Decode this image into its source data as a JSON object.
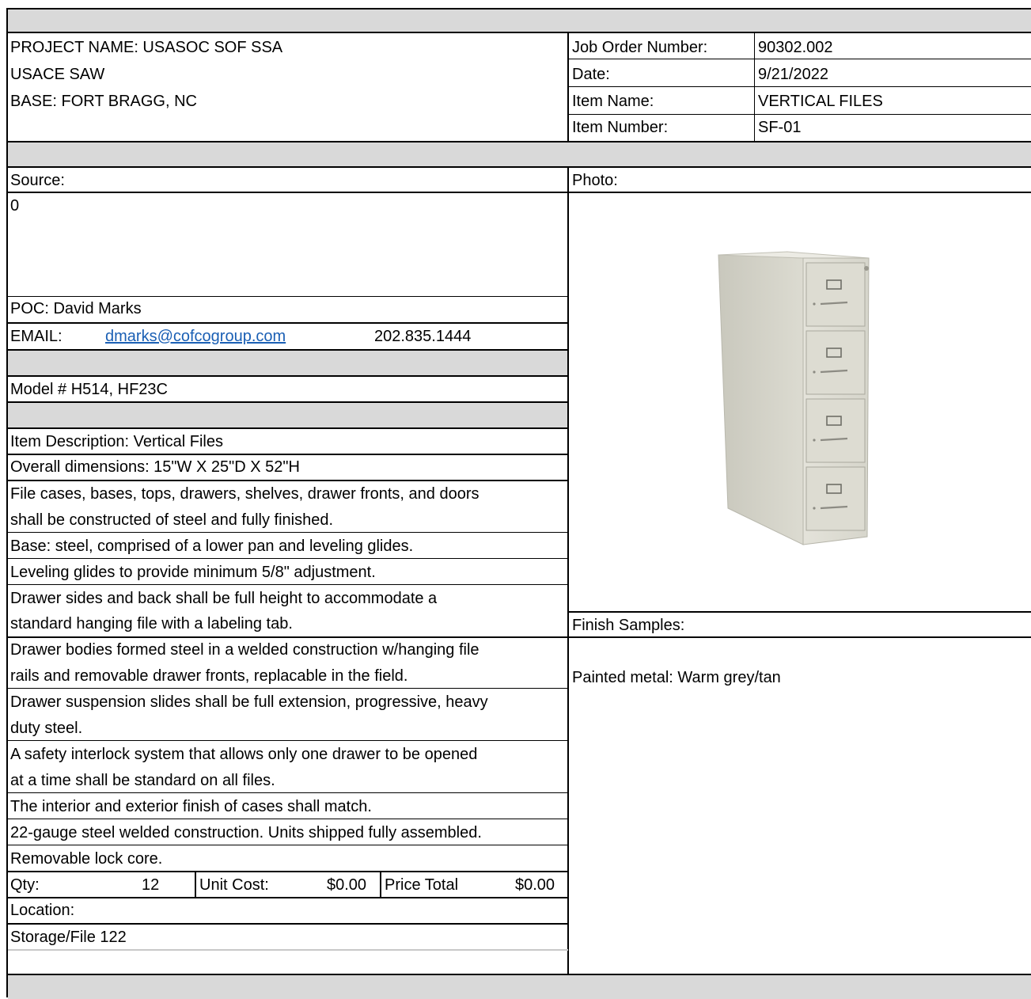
{
  "header": {
    "project_name": "PROJECT NAME: USASOC SOF SSA",
    "agency": "USACE SAW",
    "base": "BASE: FORT BRAGG, NC",
    "fields": [
      {
        "label": "Job Order Number:",
        "value": "90302.002"
      },
      {
        "label": "Date:",
        "value": "9/21/2022"
      },
      {
        "label": "Item Name:",
        "value": "VERTICAL FILES"
      },
      {
        "label": "Item Number:",
        "value": "SF-01"
      }
    ]
  },
  "source": {
    "label": "Source:",
    "value": "0",
    "poc": "POC: David Marks",
    "email_label": "EMAIL:",
    "email": "dmarks@cofcogroup.com",
    "phone": "202.835.1444"
  },
  "model": "Model # H514, HF23C",
  "description": {
    "title": "Item Description: Vertical Files",
    "dimensions": "Overall dimensions: 15\"W X 25\"D X 52\"H",
    "lines": [
      [
        "File cases, bases, tops, drawers, shelves, drawer fronts, and doors",
        "shall be constructed of steel and fully finished."
      ],
      [
        "Base: steel, comprised of a lower pan and leveling glides."
      ],
      [
        "Leveling glides to provide minimum 5/8\" adjustment."
      ],
      [
        "Drawer sides and back shall be full height to accommodate a",
        "standard hanging file with a labeling tab."
      ],
      [
        "Drawer bodies formed steel in a welded construction w/hanging file",
        "rails and removable drawer fronts, replacable in the field."
      ],
      [
        "Drawer suspension slides shall be full extension, progressive, heavy",
        "duty steel."
      ],
      [
        "A safety interlock system that allows only one drawer to be opened",
        "at a time shall be standard on all files."
      ],
      [
        "The interior and exterior finish of cases shall match."
      ],
      [
        "22-gauge steel welded construction. Units shipped fully assembled."
      ],
      [
        "Removable lock core."
      ]
    ]
  },
  "pricing": {
    "qty_label": "Qty:",
    "qty": "12",
    "unit_cost_label": "Unit Cost:",
    "unit_cost": "$0.00",
    "price_total_label": "Price Total",
    "price_total": "$0.00"
  },
  "location": {
    "label": "Location:",
    "value": "Storage/File 122"
  },
  "photo": {
    "label": "Photo:",
    "icon": "filing-cabinet-image",
    "cabinet_color": "#dcdbd2"
  },
  "finish": {
    "label": "Finish Samples:",
    "value": "Painted metal: Warm grey/tan"
  }
}
